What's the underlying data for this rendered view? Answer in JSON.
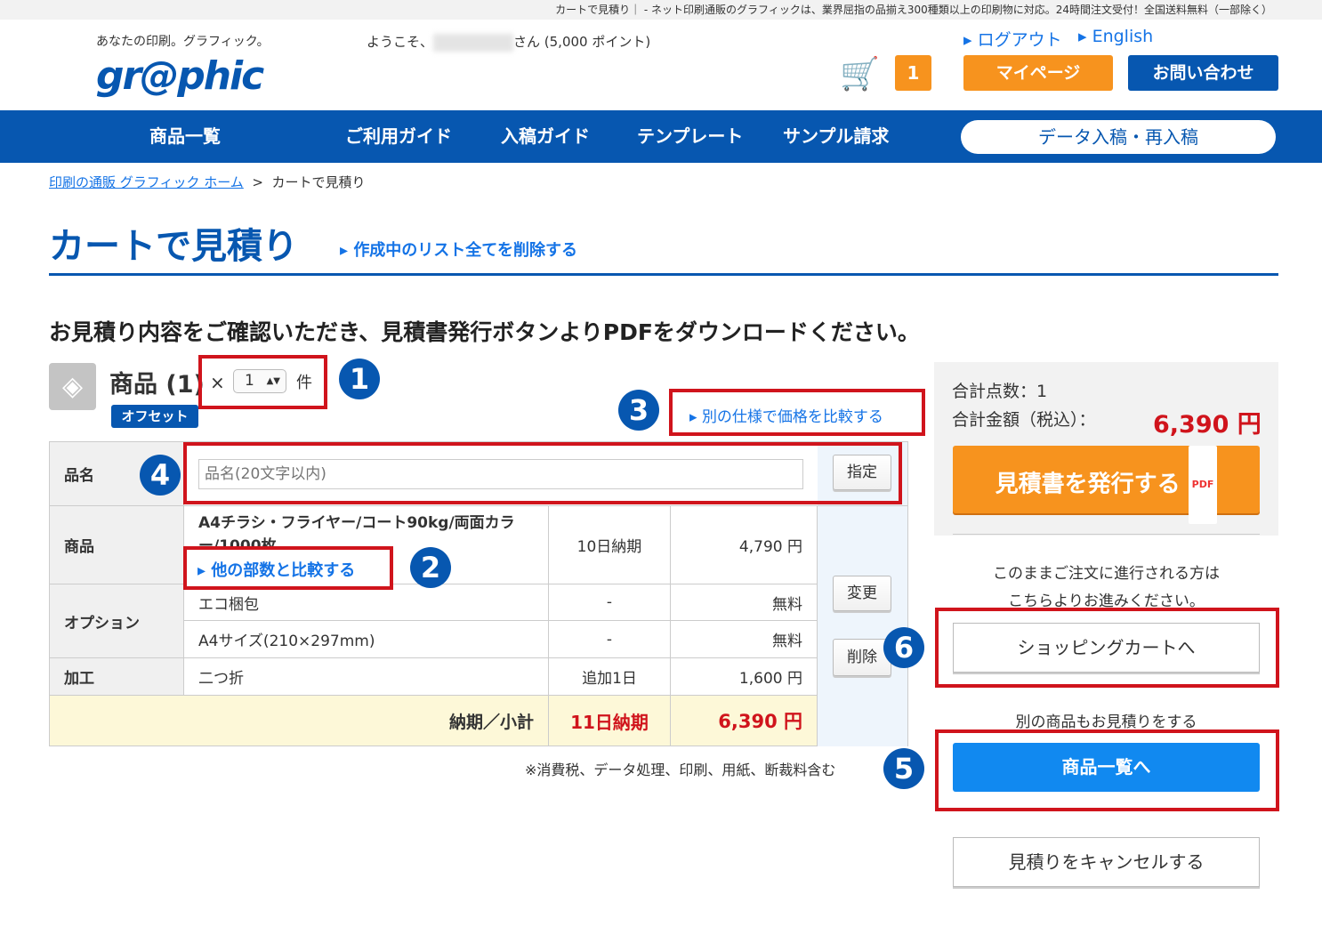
{
  "topbar": {
    "text": "カートで見積り｜ - ネット印刷通販のグラフィックは、業界屈指の品揃え300種類以上の印刷物に対応。24時間注文受付！全国送料無料（一部除く）"
  },
  "header": {
    "tagline": "あなたの印刷。グラフィック。",
    "logo": "gr@phic",
    "welcome_prefix": "ようこそ、",
    "welcome_suffix": "さん (5,000 ポイント)",
    "logout": "ログアウト",
    "english": "English",
    "cart_count": "1",
    "mypage": "マイページ",
    "contact": "お問い合わせ"
  },
  "nav": {
    "items": [
      "商品一覧",
      "ご利用ガイド",
      "入稿ガイド",
      "テンプレート",
      "サンプル請求"
    ],
    "upload": "データ入稿・再入稿"
  },
  "breadcrumb": {
    "home": "印刷の通販 グラフィック ホーム",
    "sep": ">",
    "current": "カートで見積り"
  },
  "page": {
    "title": "カートで見積り",
    "delete_all": "作成中のリスト全てを削除する",
    "instruction": "お見積り内容をご確認いただき、見積書発行ボタンよりPDFをダウンロードください。"
  },
  "product": {
    "heading": "商品 (1)",
    "times": "×",
    "quantity": "1",
    "unit": "件",
    "badge": "オフセット",
    "compare_spec": "別の仕様で価格を比較する",
    "name_label": "品名",
    "name_placeholder": "品名(20文字以内)",
    "name_button": "指定",
    "product_label": "商品",
    "product_desc": "A4チラシ・フライヤー/コート90kg/両面カラー/1000枚",
    "compare_qty": "他の部数と比較する",
    "product_delivery": "10日納期",
    "product_price": "4,790 円",
    "option_label": "オプション",
    "options": [
      {
        "name": "エコ梱包",
        "delivery": "-",
        "price": "無料"
      },
      {
        "name": "A4サイズ(210×297mm)",
        "delivery": "-",
        "price": "無料"
      }
    ],
    "process_label": "加工",
    "process_name": "二つ折",
    "process_delivery": "追加1日",
    "process_price": "1,600 円",
    "change": "変更",
    "delete": "削除",
    "subtotal_label": "納期／小計",
    "subtotal_delivery": "11日納期",
    "subtotal_price": "6,390 円",
    "note": "※消費税、データ処理、印刷、用紙、断裁料含む"
  },
  "summary": {
    "count_label": "合計点数：1",
    "total_label": "合計金額（税込）：",
    "total": "6,390 円",
    "issue": "見積書を発行する",
    "pdf": "PDF",
    "order_note1": "このままご注文に進行される方は",
    "order_note2": "こちらよりお進みください。",
    "cart": "ショッピングカートへ",
    "other_note": "別の商品もお見積りをする",
    "list": "商品一覧へ",
    "cancel": "見積りをキャンセルする"
  },
  "annotations": [
    "1",
    "2",
    "3",
    "4",
    "5",
    "6"
  ],
  "colors": {
    "brand": "#0757b0",
    "orange": "#f7931e",
    "red": "#d0141c",
    "link": "#1473e6"
  }
}
